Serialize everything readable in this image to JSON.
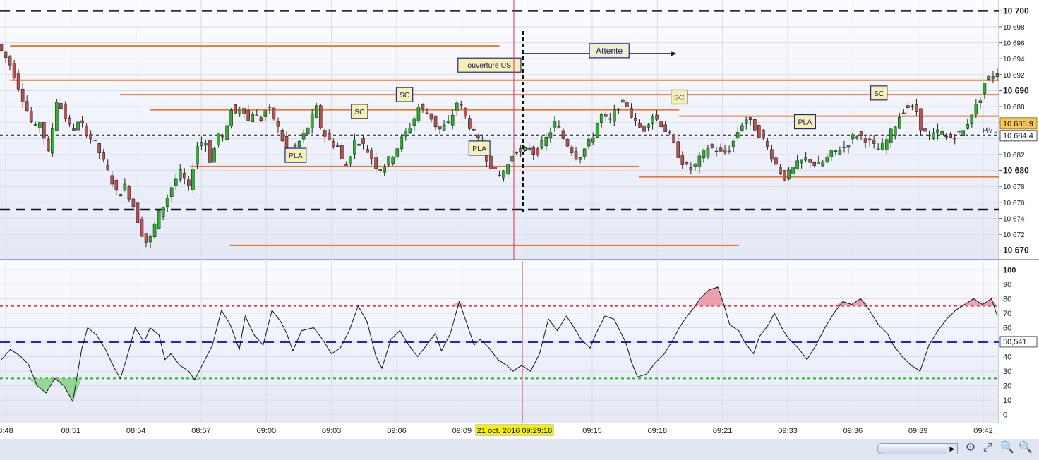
{
  "chart_data": {
    "type": "candlestick",
    "price_axis": {
      "ylim": [
        10669,
        10701
      ],
      "tick_labels": [
        "10 700",
        "10 698",
        "10 696",
        "10 694",
        "10 692",
        "10 690",
        "10 688",
        "10 686",
        "10 684",
        "10 682",
        "10 680",
        "10 678",
        "10 676",
        "10 674",
        "10 672",
        "10 670"
      ],
      "current_price_label": "10 685,9",
      "pivot_value_label": "10 684,4",
      "pivot_label": "Piv J"
    },
    "rsi_axis": {
      "ylim": [
        -5,
        105
      ],
      "tick_labels": [
        "100",
        "90",
        "80",
        "70",
        "60",
        "50",
        "40",
        "30",
        "20",
        "10",
        "0"
      ],
      "current_value_label": "50,541",
      "overbought": 75,
      "mid": 50,
      "oversold": 25
    },
    "time_axis": {
      "tick_labels": [
        "8:48",
        "08:51",
        "08:54",
        "08:57",
        "09:00",
        "09:03",
        "09:06",
        "09:09",
        "09:12",
        "09:15",
        "09:18",
        "09:21",
        "09:33",
        "09:36",
        "09:39",
        "09:42"
      ],
      "cursor_label": "21 oct. 2016 09:29:18"
    },
    "price_path": [
      [
        0,
        10695.8
      ],
      [
        10,
        10693
      ],
      [
        18,
        10689
      ],
      [
        26,
        10685
      ],
      [
        30,
        10686.2
      ],
      [
        36,
        10682
      ],
      [
        42,
        10689
      ],
      [
        52,
        10685
      ],
      [
        58,
        10686
      ],
      [
        66,
        10684
      ],
      [
        70,
        10683
      ],
      [
        76,
        10680.5
      ],
      [
        80,
        10679
      ],
      [
        84,
        10677
      ],
      [
        90,
        10678
      ],
      [
        96,
        10675.5
      ],
      [
        100,
        10673
      ],
      [
        104,
        10671
      ],
      [
        108,
        10671.5
      ],
      [
        112,
        10674
      ],
      [
        118,
        10676
      ],
      [
        124,
        10678.5
      ],
      [
        130,
        10680
      ],
      [
        134,
        10677
      ],
      [
        140,
        10683
      ],
      [
        146,
        10684
      ],
      [
        150,
        10681
      ],
      [
        156,
        10685
      ],
      [
        160,
        10683.5
      ],
      [
        164,
        10688
      ],
      [
        168,
        10687
      ],
      [
        172,
        10688.5
      ],
      [
        176,
        10686
      ],
      [
        180,
        10687.5
      ],
      [
        184,
        10686
      ],
      [
        190,
        10688
      ],
      [
        196,
        10686
      ],
      [
        200,
        10684
      ],
      [
        204,
        10682.5
      ],
      [
        210,
        10683
      ],
      [
        214,
        10684
      ],
      [
        220,
        10686
      ],
      [
        224,
        10688
      ],
      [
        228,
        10685
      ],
      [
        234,
        10683.5
      ],
      [
        240,
        10683
      ],
      [
        244,
        10680
      ],
      [
        248,
        10682
      ],
      [
        252,
        10684
      ],
      [
        258,
        10683
      ],
      [
        262,
        10682
      ],
      [
        268,
        10680
      ],
      [
        274,
        10681
      ],
      [
        280,
        10682.5
      ],
      [
        286,
        10684.5
      ],
      [
        292,
        10686
      ],
      [
        296,
        10688
      ],
      [
        304,
        10687
      ],
      [
        310,
        10685
      ],
      [
        318,
        10686
      ],
      [
        324,
        10689
      ],
      [
        328,
        10687
      ],
      [
        334,
        10685
      ],
      [
        340,
        10683
      ],
      [
        346,
        10681
      ],
      [
        352,
        10679
      ],
      [
        356,
        10680
      ],
      [
        360,
        10681
      ],
      [
        364,
        10683
      ],
      [
        368,
        10682
      ],
      [
        374,
        10683
      ],
      [
        378,
        10682
      ],
      [
        382,
        10683
      ],
      [
        386,
        10684
      ],
      [
        392,
        10686
      ],
      [
        398,
        10684
      ],
      [
        402,
        10683
      ],
      [
        408,
        10681.5
      ],
      [
        414,
        10683
      ],
      [
        418,
        10684
      ],
      [
        424,
        10687
      ],
      [
        430,
        10686
      ],
      [
        436,
        10688
      ],
      [
        442,
        10688.5
      ],
      [
        448,
        10686
      ],
      [
        454,
        10685
      ],
      [
        460,
        10687
      ],
      [
        466,
        10686
      ],
      [
        472,
        10684.5
      ],
      [
        476,
        10683
      ],
      [
        480,
        10681.5
      ],
      [
        486,
        10680
      ],
      [
        490,
        10680.5
      ],
      [
        496,
        10682
      ],
      [
        500,
        10683
      ],
      [
        506,
        10682.5
      ],
      [
        510,
        10682
      ],
      [
        516,
        10683
      ],
      [
        522,
        10685.5
      ],
      [
        526,
        10686.5
      ],
      [
        532,
        10685.5
      ],
      [
        538,
        10684
      ],
      [
        544,
        10682
      ],
      [
        548,
        10680.5
      ],
      [
        554,
        10679
      ],
      [
        558,
        10680
      ],
      [
        564,
        10681
      ],
      [
        570,
        10681.5
      ],
      [
        576,
        10680.5
      ],
      [
        580,
        10681
      ],
      [
        586,
        10682
      ],
      [
        590,
        10682.5
      ],
      [
        596,
        10683
      ],
      [
        600,
        10684
      ],
      [
        604,
        10684.5
      ],
      [
        610,
        10684
      ],
      [
        616,
        10683
      ],
      [
        620,
        10682.5
      ],
      [
        626,
        10684
      ],
      [
        632,
        10686
      ],
      [
        636,
        10687.5
      ],
      [
        640,
        10688
      ],
      [
        646,
        10687.5
      ],
      [
        650,
        10685
      ],
      [
        656,
        10684
      ],
      [
        662,
        10685
      ],
      [
        668,
        10684
      ],
      [
        674,
        10684.5
      ],
      [
        680,
        10685
      ],
      [
        684,
        10687
      ],
      [
        690,
        10688.5
      ],
      [
        694,
        10691
      ],
      [
        700,
        10692
      ]
    ],
    "rsi_path": [
      [
        0,
        38
      ],
      [
        6,
        45
      ],
      [
        12,
        41
      ],
      [
        18,
        35
      ],
      [
        24,
        20
      ],
      [
        30,
        15
      ],
      [
        36,
        25
      ],
      [
        42,
        20
      ],
      [
        48,
        9
      ],
      [
        54,
        45
      ],
      [
        58,
        60
      ],
      [
        64,
        55
      ],
      [
        70,
        45
      ],
      [
        76,
        32
      ],
      [
        80,
        25
      ],
      [
        84,
        38
      ],
      [
        90,
        60
      ],
      [
        96,
        50
      ],
      [
        100,
        60
      ],
      [
        106,
        55
      ],
      [
        110,
        38
      ],
      [
        114,
        42
      ],
      [
        120,
        34
      ],
      [
        126,
        30
      ],
      [
        130,
        24
      ],
      [
        136,
        36
      ],
      [
        142,
        48
      ],
      [
        148,
        72
      ],
      [
        154,
        62
      ],
      [
        160,
        45
      ],
      [
        164,
        68
      ],
      [
        170,
        55
      ],
      [
        176,
        48
      ],
      [
        182,
        72
      ],
      [
        188,
        64
      ],
      [
        192,
        56
      ],
      [
        196,
        44
      ],
      [
        202,
        58
      ],
      [
        210,
        60
      ],
      [
        216,
        52
      ],
      [
        222,
        42
      ],
      [
        228,
        46
      ],
      [
        234,
        58
      ],
      [
        240,
        75
      ],
      [
        246,
        64
      ],
      [
        252,
        40
      ],
      [
        256,
        32
      ],
      [
        262,
        52
      ],
      [
        268,
        58
      ],
      [
        274,
        48
      ],
      [
        280,
        40
      ],
      [
        286,
        48
      ],
      [
        292,
        56
      ],
      [
        296,
        44
      ],
      [
        302,
        56
      ],
      [
        308,
        78
      ],
      [
        312,
        66
      ],
      [
        318,
        48
      ],
      [
        322,
        52
      ],
      [
        328,
        46
      ],
      [
        334,
        38
      ],
      [
        340,
        34
      ],
      [
        344,
        30
      ],
      [
        350,
        34
      ],
      [
        356,
        30
      ],
      [
        362,
        42
      ],
      [
        368,
        66
      ],
      [
        374,
        58
      ],
      [
        380,
        68
      ],
      [
        384,
        62
      ],
      [
        390,
        52
      ],
      [
        396,
        46
      ],
      [
        400,
        56
      ],
      [
        406,
        68
      ],
      [
        412,
        66
      ],
      [
        416,
        58
      ],
      [
        420,
        50
      ],
      [
        424,
        36
      ],
      [
        428,
        26
      ],
      [
        434,
        28
      ],
      [
        440,
        36
      ],
      [
        446,
        42
      ],
      [
        452,
        52
      ],
      [
        456,
        60
      ],
      [
        460,
        66
      ],
      [
        466,
        74
      ],
      [
        470,
        80
      ],
      [
        476,
        86
      ],
      [
        482,
        88
      ],
      [
        486,
        76
      ],
      [
        490,
        62
      ],
      [
        496,
        58
      ],
      [
        500,
        50
      ],
      [
        506,
        42
      ],
      [
        510,
        54
      ],
      [
        516,
        62
      ],
      [
        520,
        70
      ],
      [
        526,
        58
      ],
      [
        530,
        52
      ],
      [
        536,
        46
      ],
      [
        542,
        38
      ],
      [
        548,
        48
      ],
      [
        554,
        60
      ],
      [
        560,
        70
      ],
      [
        566,
        78
      ],
      [
        572,
        76
      ],
      [
        578,
        80
      ],
      [
        584,
        72
      ],
      [
        590,
        62
      ],
      [
        596,
        56
      ],
      [
        600,
        48
      ],
      [
        606,
        40
      ],
      [
        612,
        34
      ],
      [
        618,
        30
      ],
      [
        624,
        48
      ],
      [
        630,
        58
      ],
      [
        636,
        66
      ],
      [
        642,
        72
      ],
      [
        648,
        76
      ],
      [
        654,
        80
      ],
      [
        660,
        76
      ],
      [
        666,
        80
      ],
      [
        670,
        68
      ]
    ],
    "levels": [
      {
        "value": 10695.6,
        "from": 0.01,
        "to": 0.5
      },
      {
        "value": 10691.3,
        "from": 0.01,
        "to": 1.0
      },
      {
        "value": 10689.5,
        "from": 0.12,
        "to": 1.0
      },
      {
        "value": 10687.6,
        "from": 0.15,
        "to": 0.68
      },
      {
        "value": 10686.8,
        "from": 0.68,
        "to": 1.0
      },
      {
        "value": 10680.5,
        "from": 0.19,
        "to": 0.64
      },
      {
        "value": 10679.2,
        "from": 0.64,
        "to": 1.0
      },
      {
        "value": 10670.6,
        "from": 0.23,
        "to": 0.74
      }
    ],
    "dashed_levels": [
      10700,
      10675.1
    ],
    "pivot_level": 10684.4,
    "annotations": [
      {
        "text": "ouverture US",
        "t": 0.49,
        "v": 10693.2
      },
      {
        "text": "Attente",
        "t": 0.61,
        "v": 10695
      },
      {
        "text": "SC",
        "t": 0.405,
        "v": 10689.5
      },
      {
        "text": "SC",
        "t": 0.36,
        "v": 10687.4
      },
      {
        "text": "SC",
        "t": 0.68,
        "v": 10689.2
      },
      {
        "text": "SC",
        "t": 0.88,
        "v": 10689.7
      },
      {
        "text": "PLA",
        "t": 0.296,
        "v": 10681.9
      },
      {
        "text": "PLA",
        "t": 0.48,
        "v": 10682.8
      },
      {
        "text": "PLA",
        "t": 0.806,
        "v": 10686.1
      }
    ]
  },
  "colors": {
    "bull": "#2db42d",
    "bear": "#c0504d",
    "level": "#f0772a",
    "ob": "#e0304a",
    "os": "#21b821",
    "mid": "#1c28d6",
    "label_bg": "#f8f0b0",
    "label_border": "#1c2c8a"
  },
  "toolbar": {
    "icons": [
      "chart-settings-icon",
      "zoom-fit-icon",
      "zoom-out-icon",
      "zoom-in-icon"
    ]
  }
}
